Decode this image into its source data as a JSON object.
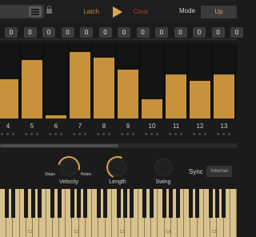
{
  "header": {
    "latch_label": "Latch",
    "clear_label": "Clear",
    "mode_label": "Mode",
    "mode_value": "Up",
    "accent_color": "#e0a54a",
    "clear_color": "#a0413a"
  },
  "steps": {
    "values": [
      "0",
      "0",
      "0",
      "0",
      "0",
      "0",
      "0",
      "0",
      "0",
      "0",
      "0",
      "0",
      "0"
    ],
    "numbers": [
      "4",
      "5",
      "6",
      "7",
      "8",
      "9",
      "10",
      "11",
      "12",
      "13"
    ],
    "bar_levels": [
      0.52,
      0.78,
      0.04,
      0.88,
      0.81,
      0.65,
      0.25,
      0.58,
      0.5,
      0.58
    ]
  },
  "knobs": {
    "velocity_label": "Velocity",
    "steps_label": "Steps",
    "notes_label": "Notes",
    "length_label": "Length",
    "swing_label": "Swing"
  },
  "sync": {
    "label": "Sync",
    "value": "Internal"
  },
  "keyboard": {
    "labels": [
      "C1",
      "C2",
      "C3",
      "C4",
      "C5"
    ]
  }
}
